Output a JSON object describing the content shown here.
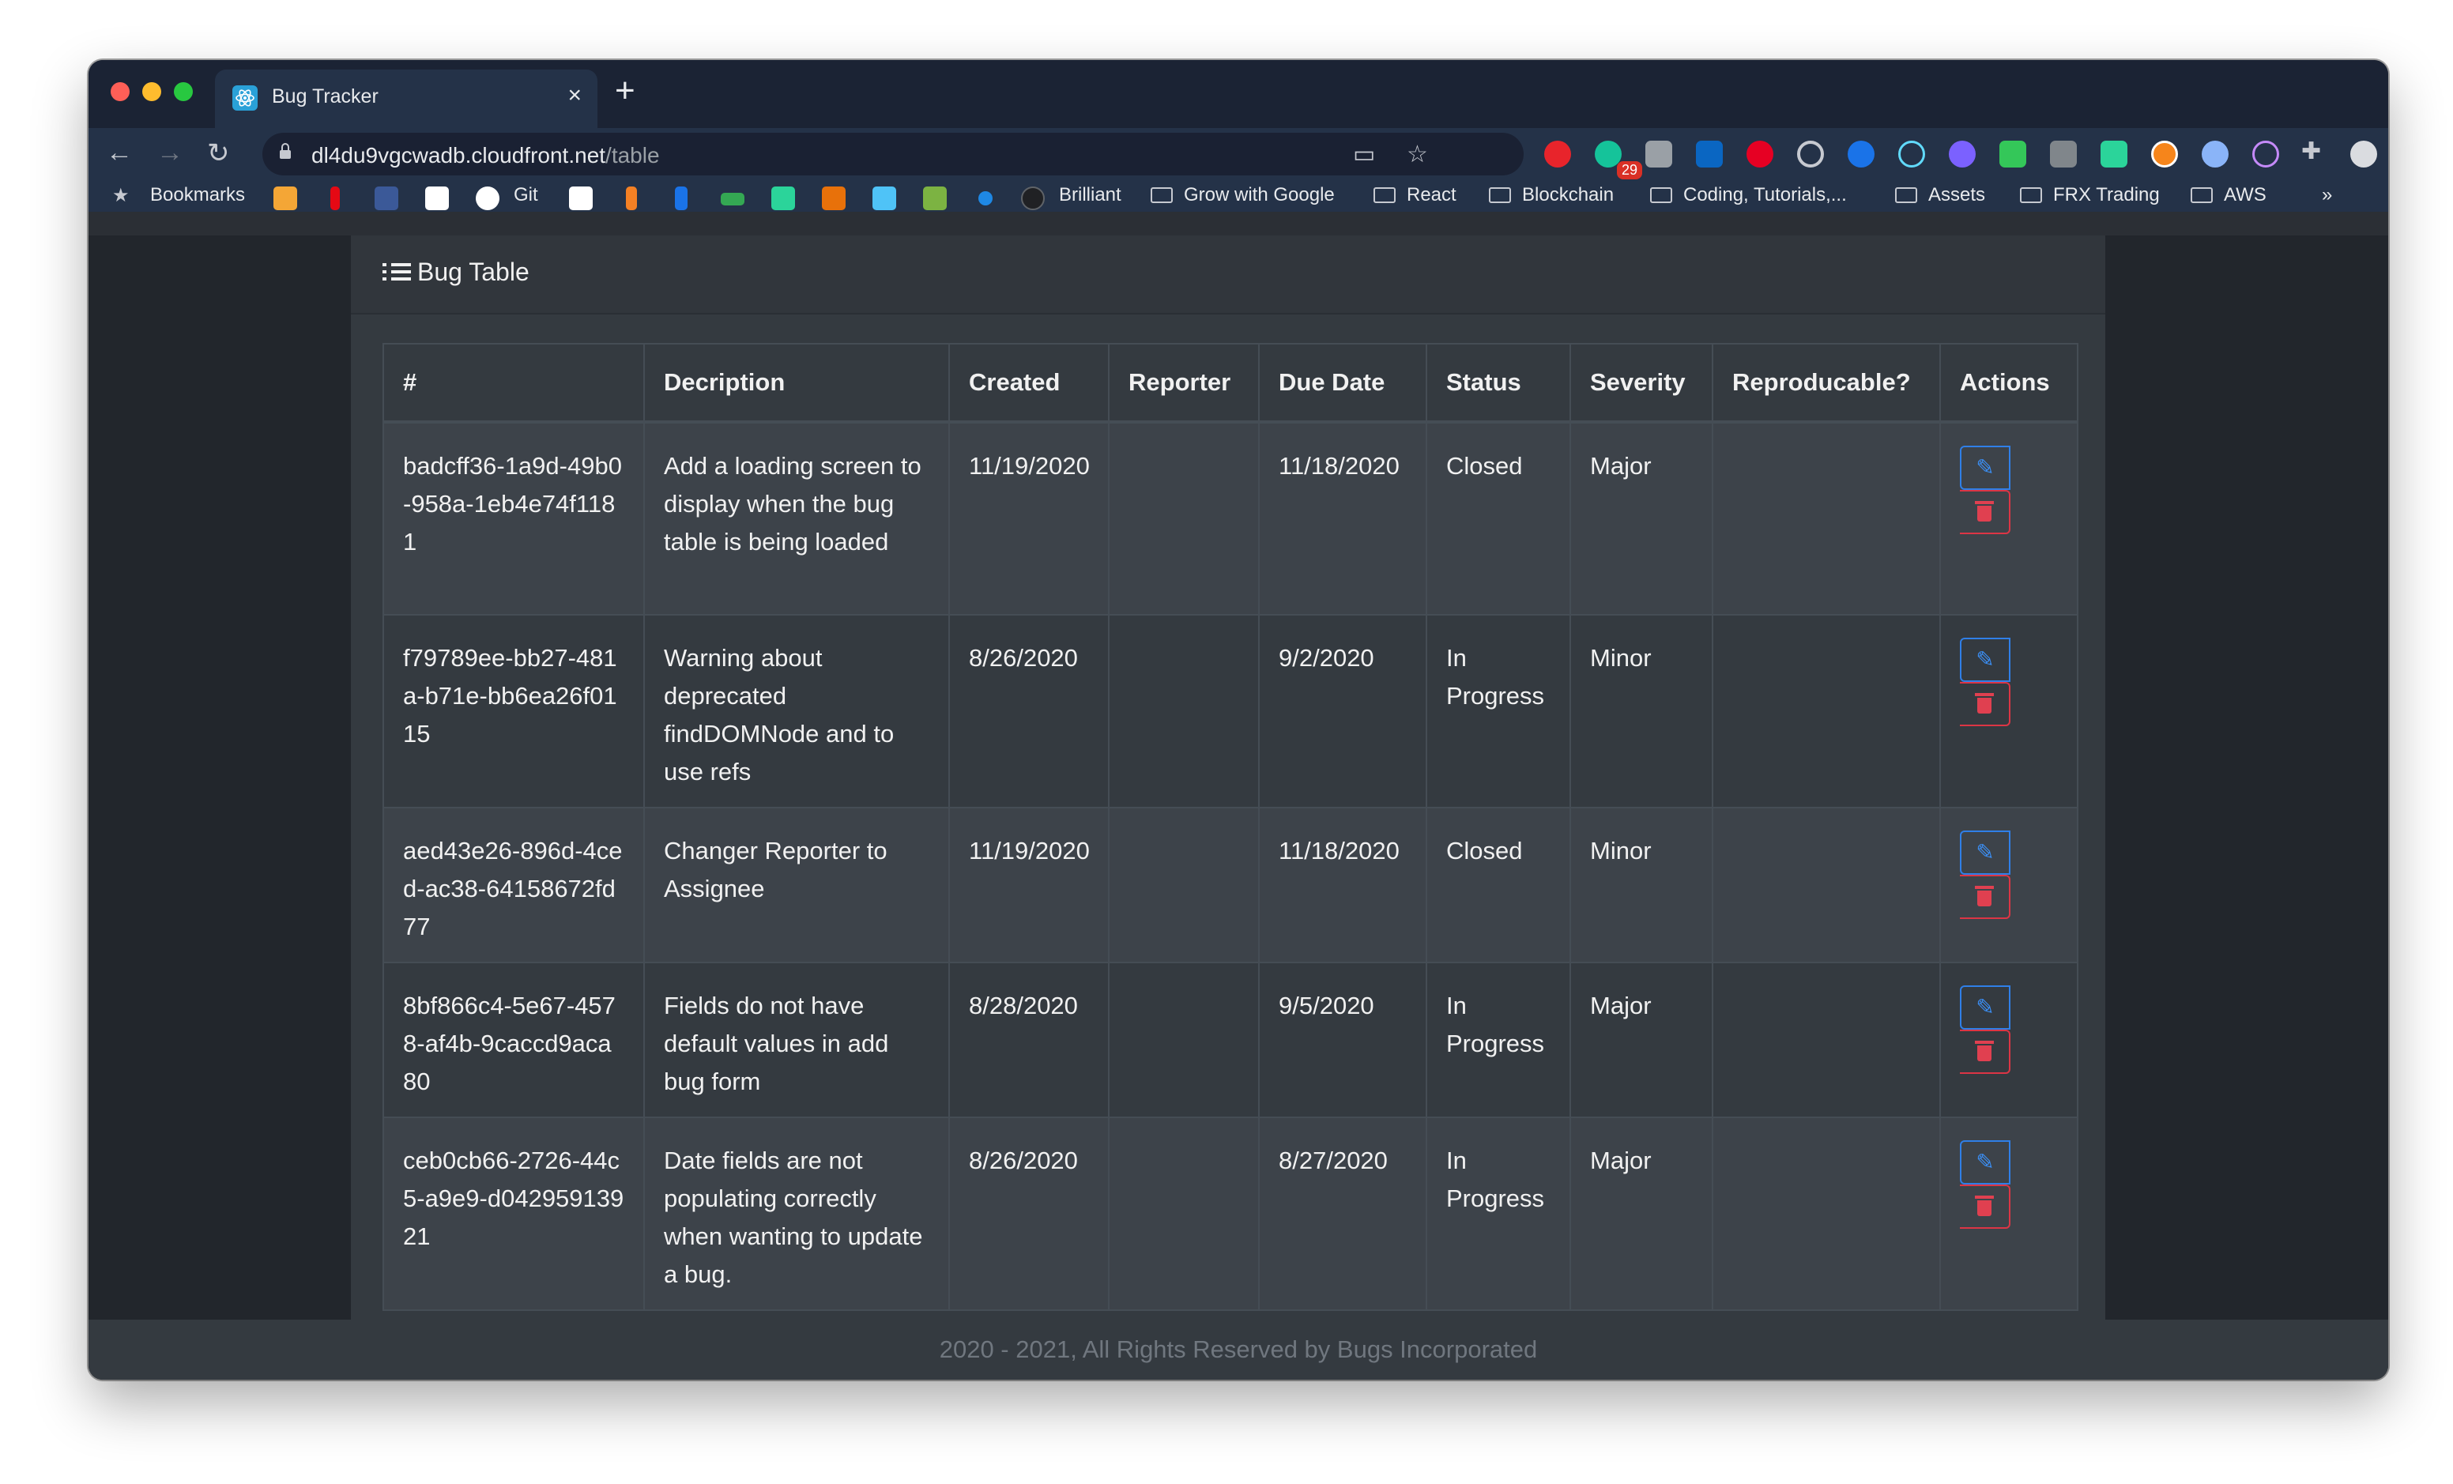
{
  "browser": {
    "tab_title": "Bug Tracker",
    "tab_close": "×",
    "new_tab": "+",
    "url_host": "dl4du9vgcwadb.cloudfront.net",
    "url_path": "/table",
    "extension_badge": "29",
    "bookmarks": {
      "label": "Bookmarks",
      "git": "Git",
      "brilliant": "Brilliant",
      "folders": [
        "Grow with Google",
        "React",
        "Blockchain",
        "Coding, Tutorials,...",
        "Assets",
        "FRX Trading",
        "AWS"
      ],
      "more": "»"
    }
  },
  "page": {
    "card_title": "Bug Table",
    "footer": "2020 - 2021, All Rights Reserved by Bugs Incorporated"
  },
  "table": {
    "headers": [
      "#",
      "Decription",
      "Created",
      "Reporter",
      "Due Date",
      "Status",
      "Severity",
      "Reproducable?",
      "Actions"
    ],
    "rows": [
      {
        "id": "badcff36-1a9d-49b0-958a-1eb4e74f1181",
        "description": "Add a loading screen to display when the bug table is being loaded",
        "created": "11/19/2020",
        "reporter": "",
        "due": "11/18/2020",
        "status": "Closed",
        "severity": "Major",
        "reproducible": ""
      },
      {
        "id": "f79789ee-bb27-481a-b71e-bb6ea26f0115",
        "description": "Warning about deprecated findDOMNode and to use refs",
        "created": "8/26/2020",
        "reporter": "",
        "due": "9/2/2020",
        "status": "In Progress",
        "severity": "Minor",
        "reproducible": ""
      },
      {
        "id": "aed43e26-896d-4ced-ac38-64158672fd77",
        "description": "Changer Reporter to Assignee",
        "created": "11/19/2020",
        "reporter": "",
        "due": "11/18/2020",
        "status": "Closed",
        "severity": "Minor",
        "reproducible": ""
      },
      {
        "id": "8bf866c4-5e67-4578-af4b-9caccd9aca80",
        "description": "Fields do not have default values in add bug form",
        "created": "8/28/2020",
        "reporter": "",
        "due": "9/5/2020",
        "status": "In Progress",
        "severity": "Major",
        "reproducible": ""
      },
      {
        "id": "ceb0cb66-2726-44c5-a9e9-d04295913921",
        "description": "Date fields are not populating correctly when wanting to update a bug.",
        "created": "8/26/2020",
        "reporter": "",
        "due": "8/27/2020",
        "status": "In Progress",
        "severity": "Major",
        "reproducible": ""
      }
    ]
  },
  "icons": {
    "edit": "edit-icon",
    "delete": "trash-icon",
    "list": "list-icon"
  },
  "colors": {
    "edit_button": "#2f7fe8",
    "delete_button": "#dc3545",
    "table_bg": "#343a40"
  }
}
